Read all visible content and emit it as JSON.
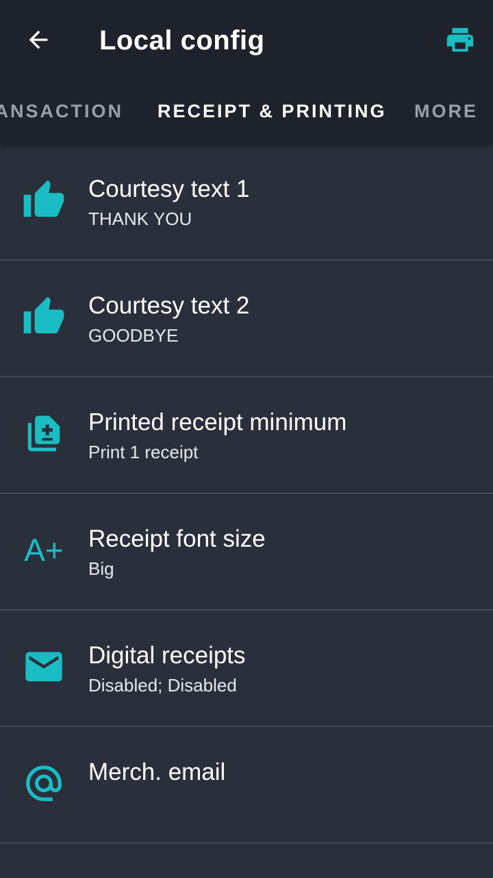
{
  "header": {
    "title": "Local config",
    "back_icon": "arrow-back-icon",
    "action_icon": "printer-icon"
  },
  "tabs": [
    {
      "label": "ANSACTION",
      "active": false
    },
    {
      "label": "RECEIPT & PRINTING",
      "active": true
    },
    {
      "label": "MORE",
      "active": false
    }
  ],
  "settings": [
    {
      "title": "Courtesy text 1",
      "subtitle": "THANK YOU",
      "icon": "thumb-up-icon"
    },
    {
      "title": "Courtesy text 2",
      "subtitle": "GOODBYE",
      "icon": "thumb-up-icon"
    },
    {
      "title": "Printed receipt minimum",
      "subtitle": "Print 1 receipt",
      "icon": "receipt-copies-icon"
    },
    {
      "title": "Receipt font size",
      "subtitle": "Big",
      "icon": "font-size-increase-icon",
      "icon_text": "A+"
    },
    {
      "title": "Digital receipts",
      "subtitle": "Disabled; Disabled",
      "icon": "envelope-icon"
    },
    {
      "title": "Merch. email",
      "subtitle": "",
      "icon": "at-sign-icon"
    }
  ],
  "colors": {
    "accent": "#1bbdc4",
    "appbar_background": "#1e232b",
    "list_background": "#2a303b",
    "divider": "#454b56"
  }
}
